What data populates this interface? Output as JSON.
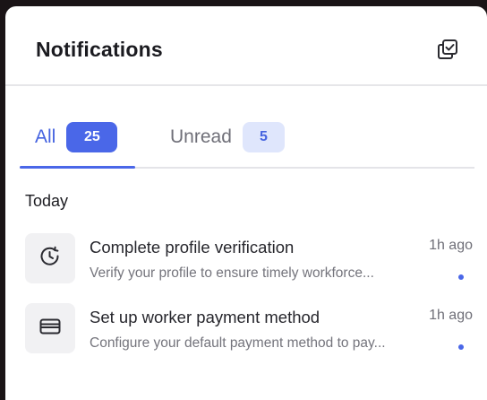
{
  "header": {
    "title": "Notifications",
    "action_icon": "mark-all-read-icon"
  },
  "tabs": [
    {
      "label": "All",
      "count": "25",
      "active": true
    },
    {
      "label": "Unread",
      "count": "5",
      "active": false
    }
  ],
  "colors": {
    "accent": "#4a67e8",
    "accent_soft": "#dfe6fc",
    "text_primary": "#1b1b20",
    "text_secondary": "#74747c"
  },
  "sections": [
    {
      "label": "Today",
      "items": [
        {
          "icon": "clock-refresh-icon",
          "title": "Complete profile verification",
          "description": "Verify your profile to ensure timely workforce...",
          "time": "1h ago",
          "unread": true
        },
        {
          "icon": "wallet-card-icon",
          "title": "Set up worker payment method",
          "description": "Configure your default payment method to pay...",
          "time": "1h ago",
          "unread": true
        }
      ]
    }
  ]
}
